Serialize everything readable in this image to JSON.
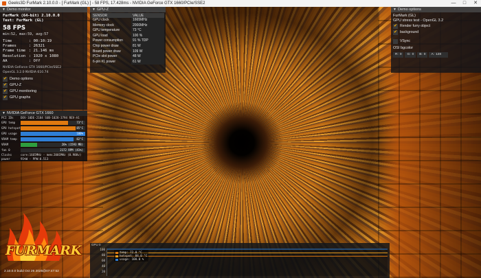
{
  "window": {
    "title": "Geeks3D FurMark 2.10.0.0 - [ FurMark (GL) ] - 58 FPS, 17.428ms - NVIDIA GeForce GTX 1660/PCIe/SSE2",
    "minimize_icon": "minimize-icon",
    "maximize_icon": "maximize-icon",
    "close_icon": "close-icon"
  },
  "demo_monitor": {
    "header": "Demo monitor",
    "title_line": "FurMark (64-bit) 2.10.0.0",
    "test_line": "Test: FurMark (GL)",
    "fps": "58 FPS",
    "minmax": "min:52, max:59, avg:57",
    "stats": [
      {
        "key": "Time",
        "value": ": 00:10:19"
      },
      {
        "key": "Frames",
        "value": ": 26321"
      },
      {
        "key": "Frame time",
        "value": ": 21.146 ms"
      },
      {
        "key": "Resolution",
        "value": ": 1920 x 1080"
      },
      {
        "key": "AA",
        "value": ": Off"
      }
    ],
    "renderer": "NVIDIA GeForce GTX 1660/PCIe/SSE2",
    "gl_version": "OpenGL 3.2.0 NVIDIA 610.74",
    "options": [
      {
        "label": "Demo options",
        "checked": true
      },
      {
        "label": "GPU-Z",
        "checked": true
      },
      {
        "label": "GPU monitoring",
        "checked": true
      },
      {
        "label": "GPU graphs",
        "checked": true
      }
    ]
  },
  "gpu_monitor": {
    "header": "NVIDIA GeForce GTX 1660",
    "pci_label": "PCI IDs",
    "pci_value": "DEV-10DE-2184 SUB-1028-3794 REV-A1",
    "rows": [
      {
        "label": "GPU temp",
        "value": "73°C",
        "fraction": 0.73,
        "color": "#e07a10"
      },
      {
        "label": "GPU hotspot",
        "value": "85°C",
        "fraction": 0.85,
        "color": "#e07a10"
      },
      {
        "label": "GPU usage",
        "value": "100%",
        "fraction": 1.0,
        "color": "#2f7fd6"
      },
      {
        "label": "VRAM temp",
        "value": "82°C",
        "fraction": 0.82,
        "color": "#2f7fd6"
      },
      {
        "label": "VRAM",
        "value": "26% (1593 MB)",
        "fraction": 0.26,
        "color": "#2e9e3e"
      },
      {
        "label": "fan 0",
        "value": "2172 RPM (41%)",
        "fraction": 0.41,
        "color": "#2a2a2a"
      }
    ],
    "clocks_label": "Clocks",
    "clocks_value": "core:1665MHz - mem:2001MHz (0.900v)",
    "power_label": "power",
    "power_value": "91%W - PPW:0.513"
  },
  "gpuz": {
    "header": "GPU-Z",
    "col_sensor": "SENSOR",
    "col_value": "VALUE",
    "rows": [
      {
        "sensor": "GPU clock",
        "value": "1665MHz"
      },
      {
        "sensor": "Memory clock",
        "value": "2000MHz"
      },
      {
        "sensor": "GPU temperature",
        "value": "73 °C"
      },
      {
        "sensor": "GPU load",
        "value": "100 %"
      },
      {
        "sensor": "Power consumption",
        "value": "91 % TDP"
      },
      {
        "sensor": "Chip power draw",
        "value": "81 W"
      },
      {
        "sensor": "Board power draw",
        "value": "109 W"
      },
      {
        "sensor": "PCIe slot power",
        "value": "48 W"
      },
      {
        "sensor": "6-pin #1 power",
        "value": "61 W"
      }
    ]
  },
  "demo_options": {
    "header": "Demo options",
    "test_name": "FurMark (GL)",
    "test_desc": "GPU stress test - OpenGL 3.2",
    "checks": [
      {
        "label": "Render furry object",
        "checked": true
      },
      {
        "label": "background",
        "checked": true
      },
      {
        "label": "VSync",
        "checked": false
      }
    ],
    "osi_label": "OSI bgcolor",
    "rgba": [
      {
        "label": "R:",
        "value": "0"
      },
      {
        "label": "G:",
        "value": "0"
      },
      {
        "label": "B:",
        "value": "0"
      },
      {
        "label": "A:",
        "value": "128"
      }
    ]
  },
  "graph": {
    "header": "GPU 0",
    "y_ticks": [
      "100",
      "80",
      "60",
      "40",
      "20"
    ],
    "legend": [
      {
        "label": "temp: 72.0 °C",
        "color": "#e07a10"
      },
      {
        "label": "hotspot: 84.0 °C",
        "color": "#f0a020"
      },
      {
        "label": "usage: 100.0 %",
        "color": "#2f7fd6"
      }
    ],
    "chart_data": {
      "type": "line",
      "ylim": [
        0,
        100
      ],
      "series": [
        {
          "name": "temp",
          "values": [
            72,
            72,
            72,
            72,
            72,
            72,
            72,
            72
          ]
        },
        {
          "name": "hotspot",
          "values": [
            84,
            84,
            84,
            84,
            84,
            84,
            84,
            84
          ]
        },
        {
          "name": "usage",
          "values": [
            100,
            100,
            100,
            100,
            100,
            100,
            100,
            100
          ]
        }
      ]
    }
  },
  "logo": {
    "word": "FURMARK",
    "build": "2.10.0.0 build Oct 26 2025@07:47:52"
  }
}
